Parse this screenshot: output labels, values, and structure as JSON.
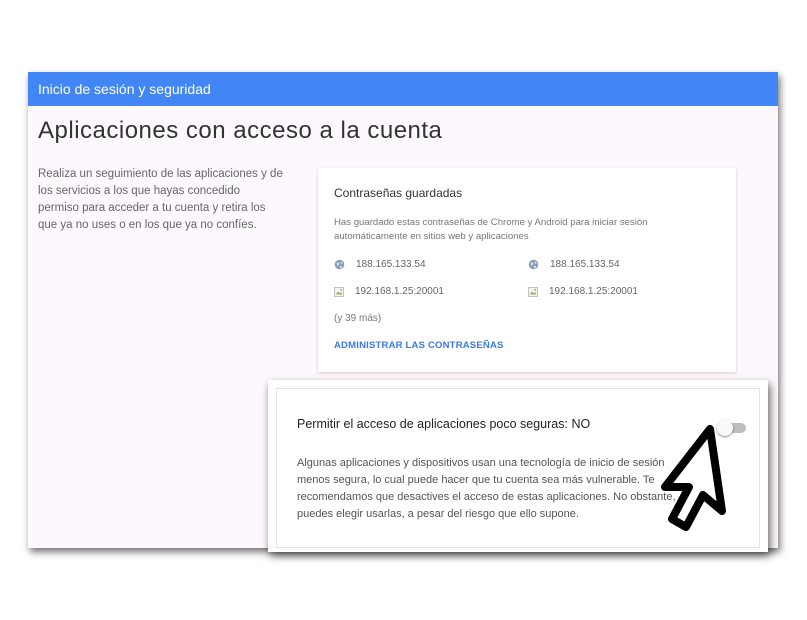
{
  "header": {
    "title": "Inicio de sesión y seguridad"
  },
  "page": {
    "title": "Aplicaciones con acceso a la cuenta"
  },
  "description": "Realiza un seguimiento de las aplicaciones y de los servicios a los que hayas concedido permiso para acceder a tu cuenta y retira los que ya no uses o en los que ya no confíes.",
  "passwords_card": {
    "title": "Contraseñas guardadas",
    "text": "Has guardado estas contraseñas de Chrome y Android para iniciar sesión automáticamente en sitios web y aplicaciones",
    "entries": [
      {
        "label": "188.165.133.54",
        "icon": "globe-icon"
      },
      {
        "label": "188.165.133.54",
        "icon": "globe-icon"
      },
      {
        "label": "192.168.1.25:20001",
        "icon": "broken-image-icon"
      },
      {
        "label": "192.168.1.25:20001",
        "icon": "broken-image-icon"
      }
    ],
    "more": "(y 39 más)",
    "manage_link": "ADMINISTRAR LAS CONTRASEÑAS"
  },
  "less_secure": {
    "title": "Permitir el acceso de aplicaciones poco seguras: NO",
    "toggle_on": false,
    "text": "Algunas aplicaciones y dispositivos usan una tecnología de inicio de sesión menos segura, lo cual puede hacer que tu cuenta sea más vulnerable. Te recomendamos que desactives el acceso de estas aplicaciones. No obstante, puedes elegir usarlas, a pesar del riesgo que ello supone."
  },
  "colors": {
    "accent": "#4285f4",
    "link": "#3b78e7"
  }
}
